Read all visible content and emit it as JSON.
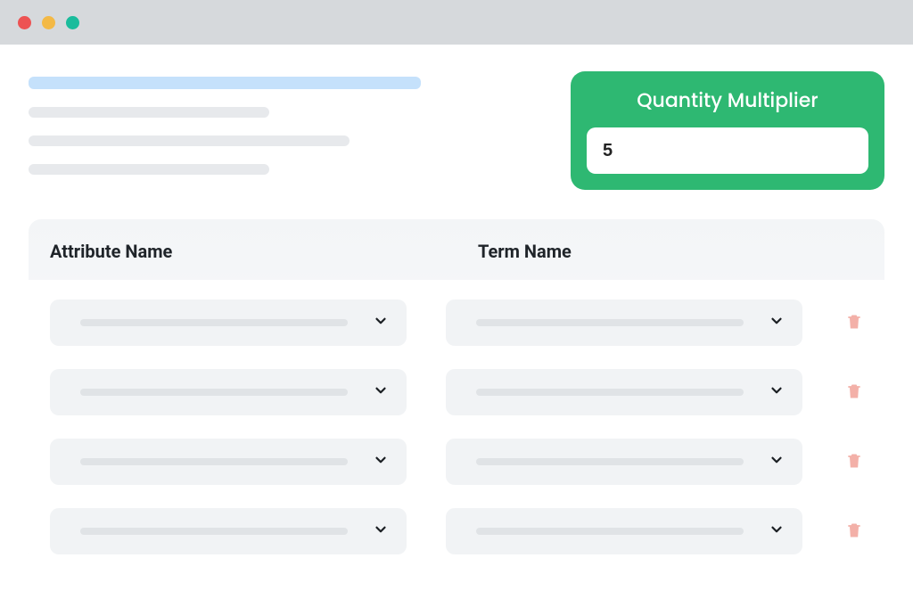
{
  "quantity_multiplier": {
    "label": "Quantity Multiplier",
    "value": "5"
  },
  "table": {
    "headers": {
      "attribute": "Attribute Name",
      "term": "Term Name"
    },
    "rows": [
      {
        "attribute": "",
        "term": ""
      },
      {
        "attribute": "",
        "term": ""
      },
      {
        "attribute": "",
        "term": ""
      },
      {
        "attribute": "",
        "term": ""
      }
    ]
  }
}
